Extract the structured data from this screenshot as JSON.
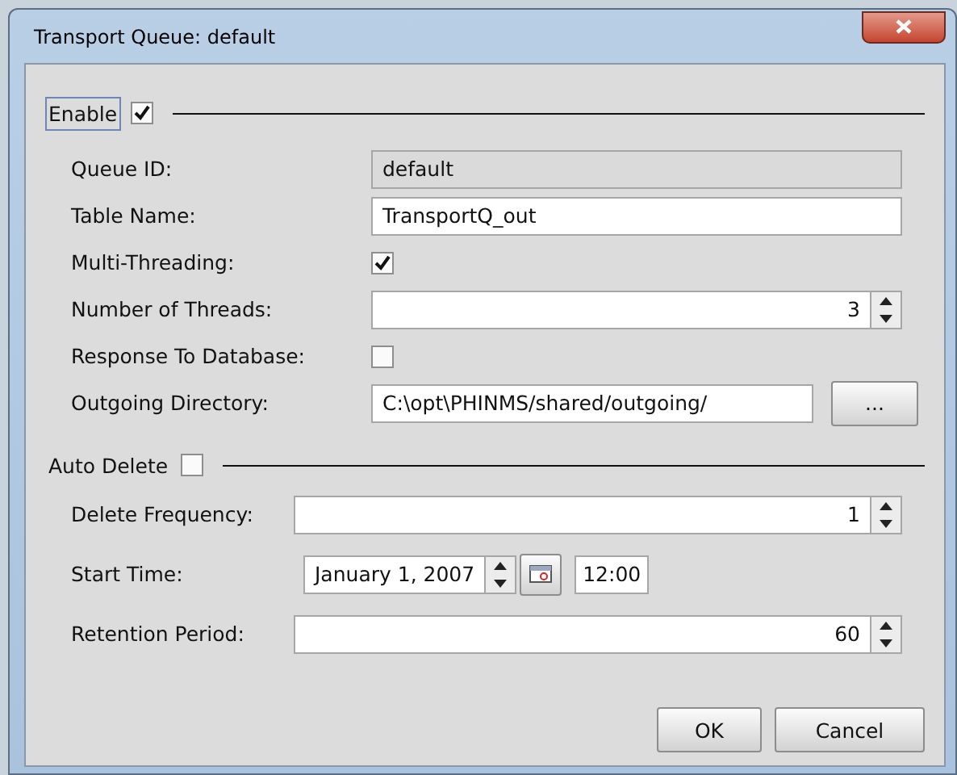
{
  "window": {
    "title": "Transport Queue: default"
  },
  "enable": {
    "label": "Enable",
    "checked": true
  },
  "queue_fields": [
    {
      "kind": "readonly",
      "label": "Queue ID:",
      "value": "default"
    },
    {
      "kind": "text",
      "label": "Table Name:",
      "value": "TransportQ_out"
    },
    {
      "kind": "checkbox",
      "label": "Multi-Threading:",
      "checked": true
    },
    {
      "kind": "spinner",
      "label": "Number of Threads:",
      "value": "3"
    },
    {
      "kind": "checkbox",
      "label": "Response To Database:",
      "checked": false
    },
    {
      "kind": "browse",
      "label": "Outgoing Directory:",
      "value": "C:\\opt\\PHINMS/shared/outgoing/",
      "button": "..."
    }
  ],
  "auto_delete": {
    "label": "Auto Delete",
    "checked": false
  },
  "delete_fields": [
    {
      "kind": "spinner",
      "label": "Delete Frequency:",
      "value": "1"
    },
    {
      "kind": "datetime",
      "label": "Start Time:",
      "date": "January 1, 2007",
      "time": "12:00"
    },
    {
      "kind": "spinner",
      "label": "Retention Period:",
      "value": "60"
    }
  ],
  "buttons": [
    "OK",
    "Cancel"
  ]
}
